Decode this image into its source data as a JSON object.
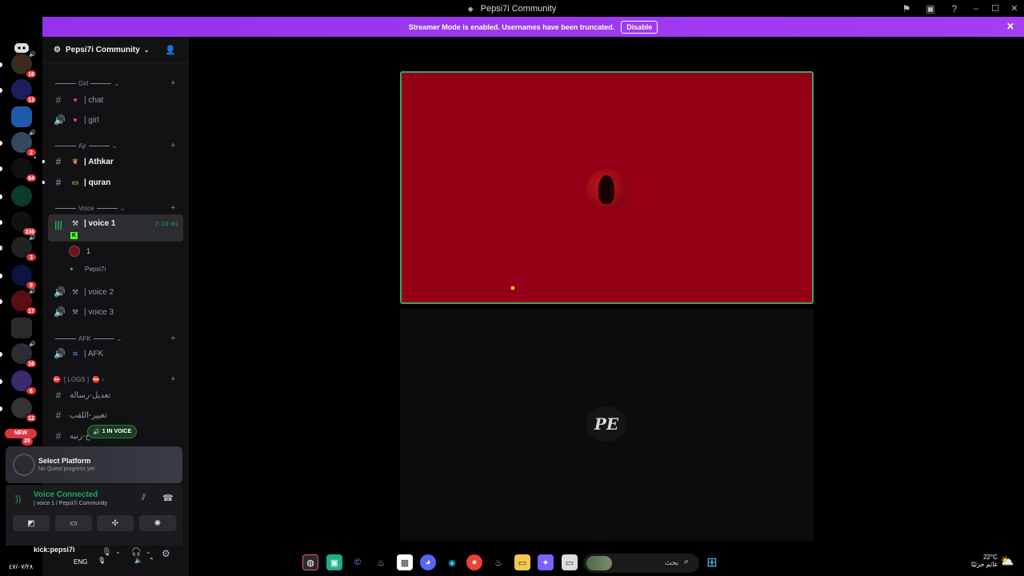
{
  "window": {
    "title": "Pepsi7i Community"
  },
  "banner": {
    "text": "Streamer Mode is enabled. Usernames have been truncated.",
    "disable_label": "Disable"
  },
  "guild_badges": [
    "16",
    "13",
    "2",
    "64",
    "336",
    "3",
    "9",
    "17",
    "16",
    "6",
    "12",
    "28"
  ],
  "guild_new_label": "NEW",
  "server": {
    "name": "Pepsi7i Community"
  },
  "categories": {
    "girl": "Girl",
    "ajr": "Ajr",
    "voice": "Voice",
    "afk": "AFK",
    "logs": "[ LOGS ]"
  },
  "channels": {
    "chat": "| chat",
    "girl": "| girl",
    "athkar": "| Athkar",
    "quran": "| quran",
    "voice1": "| voice 1",
    "voice1_time": "7:13:01",
    "voice2": "| voice 2",
    "voice3": "| voice 3",
    "afk": "| AFK",
    "log1": "تعديل-رسالة",
    "log2": "تغيير-اللقب",
    "log3": "خ-رتبه"
  },
  "voice_users": {
    "user1": "1",
    "user2": "Pepsi7i"
  },
  "in_voice_pill": "1 IN VOICE",
  "quest": {
    "title": "Select Platform",
    "subtitle": "No Quest progress yet"
  },
  "voice_panel": {
    "status": "Voice Connected",
    "location": "| voice 1 / Pepsi7i Community"
  },
  "user": {
    "name": "kick:pepsi7i"
  },
  "taskbar": {
    "search_placeholder": "بحث",
    "lang": "ENG",
    "date": "٤٧/٠٧/٢٨"
  },
  "weather": {
    "temp": "22°C",
    "desc": "غائم جزئيًا"
  },
  "stage": {
    "watermark": "PE"
  },
  "colors": {
    "accent": "#a13af0",
    "voice_green": "#23a55a",
    "stage_bg": "#950017",
    "badge_red": "#da373c"
  },
  "icons": [
    "discord-icon",
    "gear-icon",
    "hash-icon",
    "speaker-icon",
    "signal-icon",
    "mic-icon",
    "headphones-icon",
    "settings-icon",
    "search-icon",
    "windows-icon"
  ]
}
